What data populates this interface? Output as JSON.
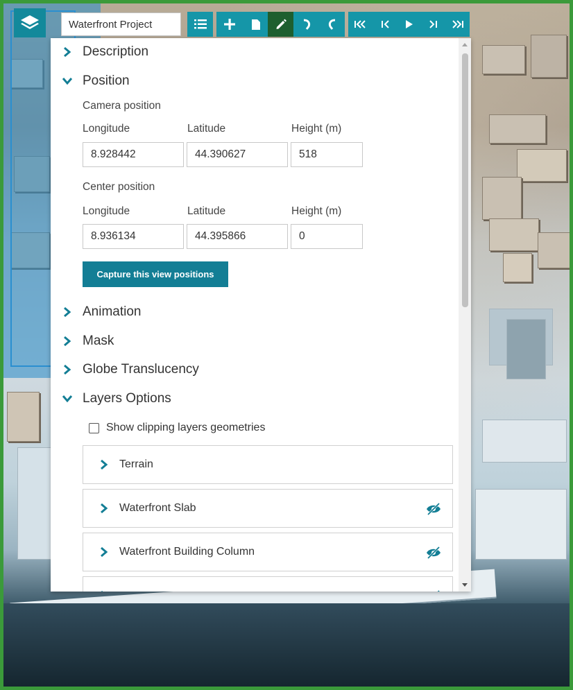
{
  "toolbar": {
    "project_name": "Waterfront Project",
    "buttons": [
      {
        "name": "story-list-icon"
      },
      {
        "name": "add-icon"
      },
      {
        "name": "copy-icon"
      },
      {
        "name": "edit-icon"
      },
      {
        "name": "undo-icon"
      },
      {
        "name": "redo-icon"
      },
      {
        "name": "first-icon"
      },
      {
        "name": "previous-icon"
      },
      {
        "name": "play-icon"
      },
      {
        "name": "next-icon"
      },
      {
        "name": "last-icon"
      }
    ]
  },
  "panel": {
    "sections": {
      "description": "Description",
      "position": "Position",
      "animation": "Animation",
      "mask": "Mask",
      "globe_translucency": "Globe Translucency",
      "layers_options": "Layers Options"
    },
    "camera": {
      "title": "Camera position",
      "longitude_label": "Longitude",
      "latitude_label": "Latitude",
      "height_label": "Height (m)",
      "longitude": "8.928442",
      "latitude": "44.390627",
      "height": "518"
    },
    "center": {
      "title": "Center position",
      "longitude_label": "Longitude",
      "latitude_label": "Latitude",
      "height_label": "Height (m)",
      "longitude": "8.936134",
      "latitude": "44.395866",
      "height": "0"
    },
    "capture_button": "Capture this view positions",
    "show_clipping": "Show clipping layers geometries",
    "layers": [
      {
        "name": "Terrain",
        "hidden": false
      },
      {
        "name": "Waterfront Slab",
        "hidden": true
      },
      {
        "name": "Waterfront Building Column",
        "hidden": true
      },
      {
        "name": "",
        "hidden": true
      }
    ]
  },
  "colors": {
    "accent": "#1596a8",
    "active": "#1e5f2f",
    "frame": "#3b9a3a"
  }
}
